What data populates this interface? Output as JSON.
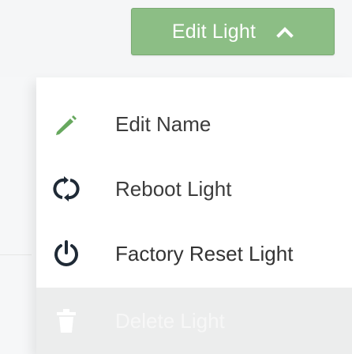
{
  "header": {
    "button_label": "Edit Light",
    "button_icon": "chevron-up-icon",
    "button_color": "#8cbe85"
  },
  "menu": {
    "items": [
      {
        "label": "Edit Name",
        "icon": "pencil-icon",
        "icon_color": "#67a85e"
      },
      {
        "label": "Reboot Light",
        "icon": "reboot-arrows-icon",
        "icon_color": "#1f2a36"
      },
      {
        "label": "Factory Reset Light",
        "icon": "power-icon",
        "icon_color": "#1f2a36"
      },
      {
        "label": "Delete Light",
        "icon": "trash-icon",
        "icon_color": "#ffffff",
        "disabled": true
      }
    ]
  }
}
